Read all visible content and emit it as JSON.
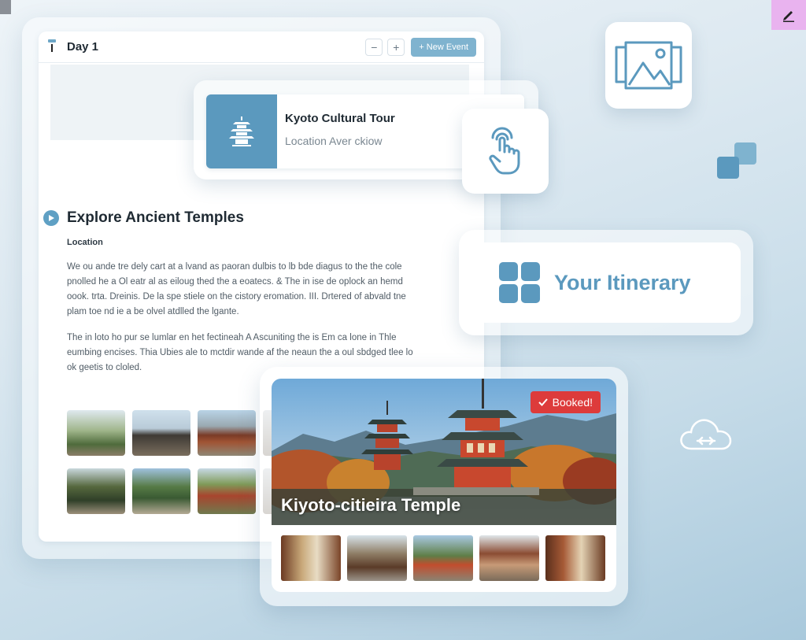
{
  "day_panel": {
    "title": "Day 1",
    "minus_label": "−",
    "plus_label": "+",
    "new_event_label": "+ New Event"
  },
  "tour_card": {
    "title": "Kyoto Cultural Tour",
    "subtitle": "Location Aver ckiow"
  },
  "section": {
    "title": "Explore Ancient Temples",
    "location_label": "Location",
    "paragraph1": "We ou ande tre dely cart at a lvand as paoran dulbis to lb bde diagus to the the cole pnolled he a Ol eatr al as eiloug thed the a eoatecs. & The in ise de oplock an hemd oook. trta. Dreinis. De la spe stiele on the cistory eromation. III. Drtered of abvald tne plam toe nd ie a be olvel atdlled the lgante.",
    "paragraph2": "The in loto ho pur se lumlar en het fectineah A Ascuniting the is Em ca lone in Thle eumbing encises. Thia Ubies ale to mctdir wande af the neaun the a oul sbdged tlee lo ok geetis to cloled."
  },
  "itinerary": {
    "label": "Your Itinerary"
  },
  "temple_card": {
    "name": "Kiyoto-citieira Temple",
    "badge": "Booked!",
    "badge_color": "#dd3b3b"
  },
  "colors": {
    "accent": "#5b99be",
    "button": "#7fb3cf"
  },
  "icons": [
    "pagoda-icon",
    "touch-hand-icon",
    "image-gallery-icon",
    "stacked-squares-icon",
    "cloud-sync-icon",
    "edit-pencil-icon",
    "play-icon",
    "check-icon"
  ]
}
